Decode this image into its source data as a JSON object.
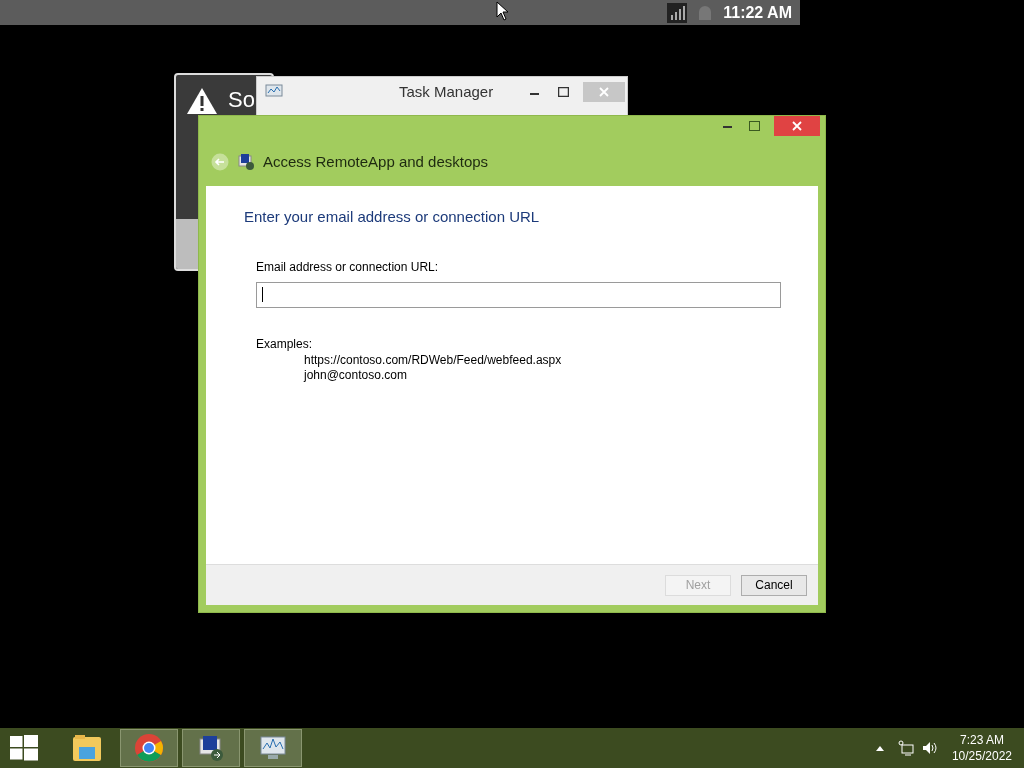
{
  "top_bar": {
    "time": "11:22 AM"
  },
  "background_dialog": {
    "title": "So"
  },
  "task_manager": {
    "title": "Task Manager"
  },
  "wizard": {
    "title": "Access RemoteApp and desktops",
    "heading": "Enter your email address or connection URL",
    "field_label": "Email address or connection URL:",
    "examples_label": "Examples:",
    "examples": [
      "https://contoso.com/RDWeb/Feed/webfeed.aspx",
      "john@contoso.com"
    ],
    "buttons": [
      {
        "label": "Next",
        "disabled": true
      },
      {
        "label": "Cancel",
        "disabled": false
      }
    ]
  },
  "taskbar": {
    "apps": [
      {
        "kind": "explorer",
        "running": false
      },
      {
        "kind": "chrome",
        "running": true
      },
      {
        "kind": "remote",
        "running": true
      },
      {
        "kind": "monitor",
        "running": true
      }
    ],
    "clock": {
      "time": "7:23 AM",
      "date": "10/25/2022"
    }
  }
}
